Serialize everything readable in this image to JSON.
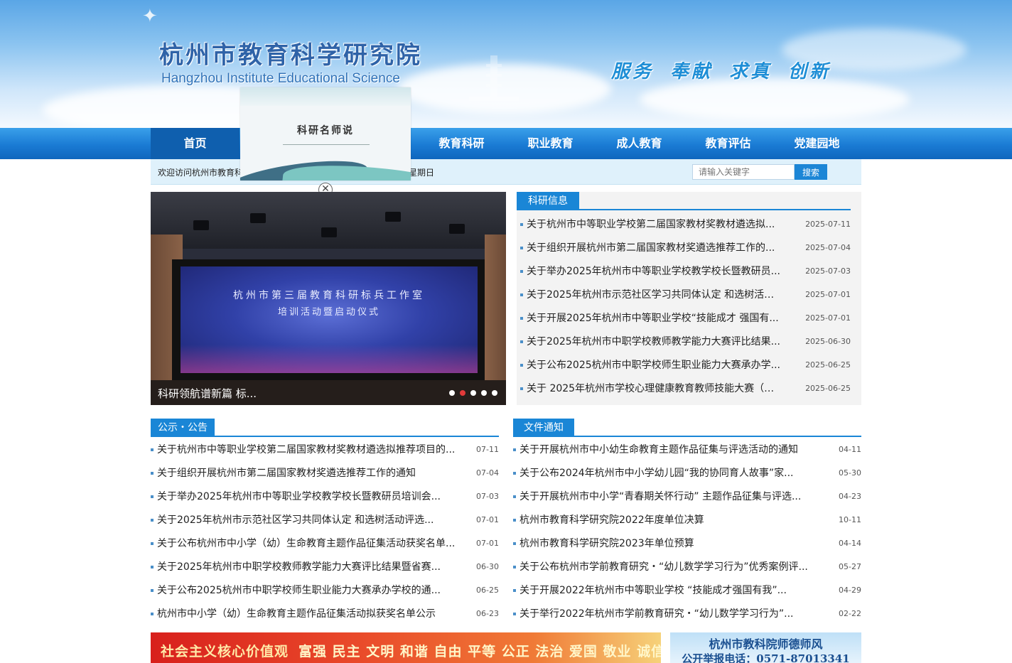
{
  "header": {
    "title_cn": "杭州市教育科学研究院",
    "title_en": "Hangzhou Institute Educational Science",
    "slogan": "服务 奉献 求真 创新"
  },
  "nav": {
    "items": [
      {
        "label": "首页"
      },
      {
        "label": "教育科研"
      },
      {
        "label": "职业教育"
      },
      {
        "label": "成人教育"
      },
      {
        "label": "教育评估"
      },
      {
        "label": "党建园地"
      }
    ]
  },
  "infobar": {
    "welcome": "欢迎访问杭州市教育科",
    "weekday": "星期日",
    "search_placeholder": "请输入关键字",
    "search_button": "搜索"
  },
  "popup": {
    "title": "科研名师说",
    "close_glyph": "✕"
  },
  "slider": {
    "screen_title_1": "杭州市第三届教育科研标兵工作室",
    "screen_title_2": "培训活动暨启动仪式",
    "caption": "科研领航谱新篇 标...",
    "dot_count": 5,
    "active_dot": 1
  },
  "research_news": {
    "title": "科研信息",
    "items": [
      {
        "text": "关于杭州市中等职业学校第二届国家教材奖教材遴选拟...",
        "date": "2025-07-11"
      },
      {
        "text": "关于组织开展杭州市第二届国家教材奖遴选推荐工作的...",
        "date": "2025-07-04"
      },
      {
        "text": "关于举办2025年杭州市中等职业学校教学校长暨教研员...",
        "date": "2025-07-03"
      },
      {
        "text": "关于2025年杭州市示范社区学习共同体认定 和选树活动...",
        "date": "2025-07-01"
      },
      {
        "text": "关于开展2025年杭州市中等职业学校“技能成才 强国有...",
        "date": "2025-07-01"
      },
      {
        "text": "关于2025年杭州市中职学校教师教学能力大赛评比结果...",
        "date": "2025-06-30"
      },
      {
        "text": "关于公布2025杭州市中职学校师生职业能力大赛承办学...",
        "date": "2025-06-25"
      },
      {
        "text": "关于 2025年杭州市学校心理健康教育教师技能大赛（职...",
        "date": "2025-06-25"
      }
    ]
  },
  "notices": {
    "title": "公示・公告",
    "items": [
      {
        "text": "关于杭州市中等职业学校第二届国家教材奖教材遴选拟推荐项目的...",
        "date": "07-11"
      },
      {
        "text": "关于组织开展杭州市第二届国家教材奖遴选推荐工作的通知",
        "date": "07-04"
      },
      {
        "text": "关于举办2025年杭州市中等职业学校教学校长暨教研员培训会...",
        "date": "07-03"
      },
      {
        "text": "关于2025年杭州市示范社区学习共同体认定 和选树活动评选...",
        "date": "07-01"
      },
      {
        "text": "关于公布杭州市中小学（幼）生命教育主题作品征集活动获奖名单...",
        "date": "07-01"
      },
      {
        "text": "关于2025年杭州市中职学校教师教学能力大赛评比结果暨省赛...",
        "date": "06-30"
      },
      {
        "text": "关于公布2025杭州市中职学校师生职业能力大赛承办学校的通...",
        "date": "06-25"
      },
      {
        "text": "杭州市中小学（幼）生命教育主题作品征集活动拟获奖名单公示",
        "date": "06-23"
      }
    ]
  },
  "documents": {
    "title": "文件通知",
    "items": [
      {
        "text": "关于开展杭州市中小幼生命教育主题作品征集与评选活动的通知",
        "date": "04-11"
      },
      {
        "text": "关于公布2024年杭州市中小学幼儿园“我的协同育人故事”家...",
        "date": "05-30"
      },
      {
        "text": "关于开展杭州市中小学“青春期关怀行动” 主题作品征集与评选...",
        "date": "04-23"
      },
      {
        "text": "杭州市教育科学研究院2022年度单位决算",
        "date": "10-11"
      },
      {
        "text": "杭州市教育科学研究院2023年单位预算",
        "date": "04-14"
      },
      {
        "text": "关于公布杭州市学前教育研究・“幼儿数学学习行为”优秀案例评...",
        "date": "05-27"
      },
      {
        "text": "关于开展2022年杭州市中等职业学校 “技能成才强国有我”...",
        "date": "04-29"
      },
      {
        "text": "关于举行2022年杭州市学前教育研究・“幼儿数学学习行为”...",
        "date": "02-22"
      }
    ]
  },
  "footer": {
    "values_title": "社会主义核心价值观",
    "values_text": "富强 民主 文明 和谐 自由 平等 公正 法治 爱国 敬业 诚信 友善",
    "ethics_line1": "杭州市教科院师德师风",
    "ethics_line2": "公开举报电话：0571-87013341"
  }
}
